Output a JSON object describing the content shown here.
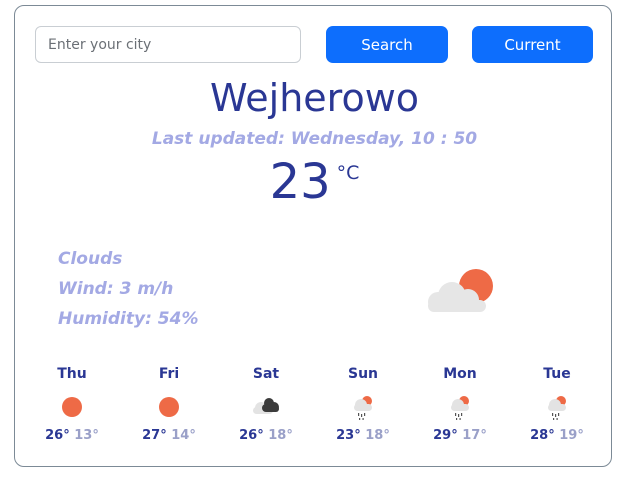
{
  "search": {
    "placeholder": "Enter your city",
    "value": ""
  },
  "buttons": {
    "search_label": "Search",
    "current_label": "Current"
  },
  "weather": {
    "city": "Wejherowo",
    "last_updated": "Last updated: Wednesday, 10 : 50",
    "temperature": "23",
    "unit": "°C",
    "description": "Clouds",
    "wind": "Wind: 3 m/h",
    "humidity": "Humidity: 54%",
    "icon": "partly-cloudy-icon"
  },
  "forecast": [
    {
      "day": "Thu",
      "max": "26°",
      "min": "13°",
      "icon": "sun-icon"
    },
    {
      "day": "Fri",
      "max": "27°",
      "min": "14°",
      "icon": "sun-icon"
    },
    {
      "day": "Sat",
      "max": "26°",
      "min": "18°",
      "icon": "broken-clouds-icon"
    },
    {
      "day": "Sun",
      "max": "23°",
      "min": "18°",
      "icon": "rain-sun-icon"
    },
    {
      "day": "Mon",
      "max": "29°",
      "min": "17°",
      "icon": "rain-sun-icon"
    },
    {
      "day": "Tue",
      "max": "28°",
      "min": "19°",
      "icon": "rain-sun-icon"
    }
  ],
  "colors": {
    "accent": "#0d6efd",
    "title": "#2a3794",
    "muted": "#a3a9e4",
    "sun": "#ee6a46"
  }
}
